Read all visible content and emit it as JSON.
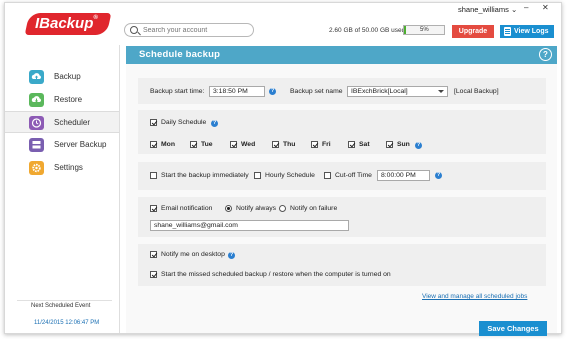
{
  "app": {
    "logo_text": "IBackup",
    "brand_color": "#e0262d",
    "accent_color": "#4ea7c8"
  },
  "header": {
    "search_placeholder": "Search your account",
    "username": "shane_williams",
    "storage_text": "2.60 GB of 50.00 GB used",
    "storage_percent": 5,
    "storage_percent_label": "5%",
    "upgrade_label": "Upgrade",
    "view_logs_label": "View Logs"
  },
  "sidebar": {
    "items": [
      {
        "label": "Backup",
        "icon": "cloud-upload-icon"
      },
      {
        "label": "Restore",
        "icon": "cloud-download-icon"
      },
      {
        "label": "Scheduler",
        "icon": "clock-icon",
        "active": true
      },
      {
        "label": "Server Backup",
        "icon": "server-icon"
      },
      {
        "label": "Settings",
        "icon": "gear-icon"
      }
    ],
    "next_event_label": "Next Scheduled Event",
    "next_event_date": "11/24/2015 12:06:47 PM"
  },
  "main": {
    "title": "Schedule backup",
    "backup_start_time_label": "Backup start time:",
    "backup_start_time": "3:18:50 PM",
    "backup_set_name_label": "Backup set name",
    "backup_set_name": "IBExchBrick[Local]",
    "backup_set_type": "[Local Backup]",
    "daily_schedule_label": "Daily Schedule",
    "days": [
      "Mon",
      "Tue",
      "Wed",
      "Thu",
      "Fri",
      "Sat",
      "Sun"
    ],
    "start_immediately_label": "Start the backup immediately",
    "hourly_schedule_label": "Hourly Schedule",
    "cutoff_time_label": "Cut-off Time",
    "cutoff_time": "8:00:00 PM",
    "email_notification_label": "Email notification",
    "notify_always_label": "Notify always",
    "notify_failure_label": "Notify on failure",
    "email": "shane_williams@gmail.com",
    "notify_desktop_label": "Notify me on desktop",
    "missed_backup_label": "Start the missed scheduled backup / restore when the computer is turned on",
    "manage_link": "View and manage all scheduled jobs",
    "save_label": "Save Changes"
  }
}
